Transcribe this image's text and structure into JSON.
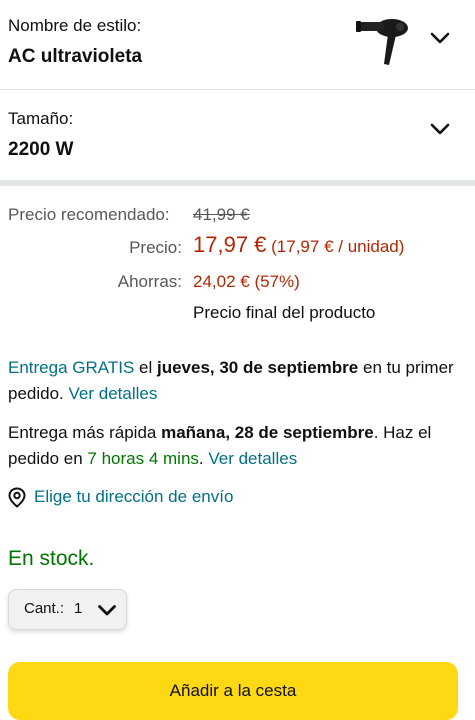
{
  "style_selector": {
    "label": "Nombre de estilo:",
    "value": "AC ultravioleta",
    "thumbnail": "hair-dryer-icon"
  },
  "size_selector": {
    "label": "Tamaño:",
    "value": "2200 W"
  },
  "pricing": {
    "list_label": "Precio recomendado:",
    "list_price": "41,99 €",
    "price_label": "Precio:",
    "price": "17,97 €",
    "unit_price": "(17,97 € / unidad)",
    "savings_label": "Ahorras:",
    "savings": "24,02 € (57%)",
    "final_note": "Precio final del producto"
  },
  "delivery": {
    "free_prefix": "Entrega GRATIS",
    "free_mid": " el ",
    "free_date": "jueves, 30 de septiembre",
    "free_suffix": " en tu primer pedido. ",
    "details_link": "Ver detalles",
    "fast_prefix": "Entrega más rápida ",
    "fast_date": "mañana, 28 de septiembre",
    "fast_mid": ". Haz el pedido en ",
    "fast_countdown": "7 horas 4 mins",
    "fast_space": ". ",
    "fast_details_link": "Ver detalles",
    "address_link": "Elige tu dirección de envío"
  },
  "stock": {
    "status": "En stock."
  },
  "quantity": {
    "label": "Cant.:",
    "value": "1"
  },
  "cart": {
    "add_label": "Añadir a la cesta"
  },
  "colors": {
    "price_red": "#b12704",
    "link_teal": "#007185",
    "stock_green": "#007600",
    "cart_yellow": "#ffd814"
  }
}
